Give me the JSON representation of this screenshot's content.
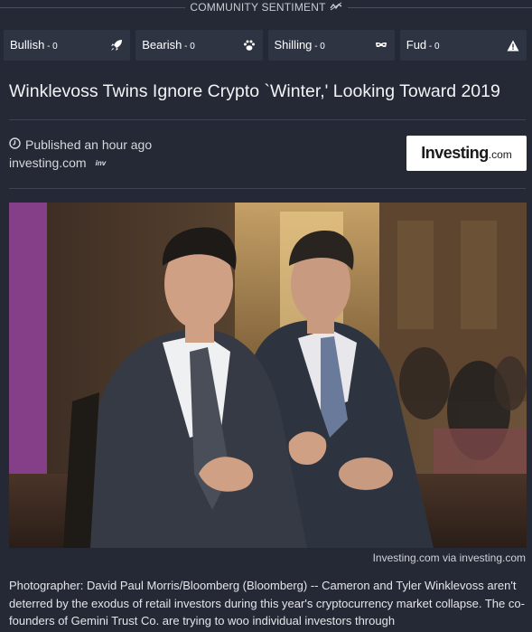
{
  "sentiment": {
    "title": "COMMUNITY SENTIMENT",
    "title_icon": "trend-squiggle-icon",
    "buttons": [
      {
        "label": "Bullish",
        "count": " - 0",
        "icon": "rocket-icon"
      },
      {
        "label": "Bearish",
        "count": " - 0",
        "icon": "paw-icon"
      },
      {
        "label": "Shilling",
        "count": " - 0",
        "icon": "mask-icon"
      },
      {
        "label": "Fud",
        "count": " - 0",
        "icon": "warning-icon"
      }
    ]
  },
  "article": {
    "headline": "Winklevoss Twins Ignore Crypto `Winter,' Looking Toward 2019",
    "published": "Published an hour ago",
    "source": "investing.com",
    "source_badge": "inv",
    "logo_text": "Investing",
    "logo_suffix": ".com",
    "image_caption": "Investing.com via investing.com",
    "body": "Photographer: David Paul Morris/Bloomberg (Bloomberg) -- Cameron and Tyler Winklevoss aren't deterred by the exodus of retail investors during this year's cryptocurrency market collapse. The co-founders of Gemini Trust Co. are trying to woo individual investors through"
  },
  "colors": {
    "background": "#252935",
    "button_bg": "#2f3442",
    "divider": "#3e4352",
    "text": "#e6e7ea"
  }
}
